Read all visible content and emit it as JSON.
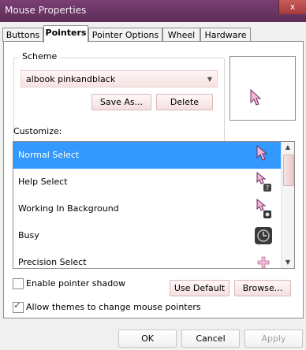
{
  "window": {
    "title": "Mouse Properties",
    "close_label": "x"
  },
  "tabs": [
    {
      "label": "Buttons"
    },
    {
      "label": "Pointers"
    },
    {
      "label": "Pointer Options"
    },
    {
      "label": "Wheel"
    },
    {
      "label": "Hardware"
    }
  ],
  "scheme": {
    "group_label": "Scheme",
    "selected": "albook pinkandblack",
    "save_as_label": "Save As...",
    "delete_label": "Delete"
  },
  "customize": {
    "label": "Customize:",
    "items": [
      {
        "label": "Normal Select",
        "icon": "pink-arrow-cursor-icon"
      },
      {
        "label": "Help Select",
        "icon": "pink-help-cursor-icon"
      },
      {
        "label": "Working In Background",
        "icon": "pink-working-cursor-icon"
      },
      {
        "label": "Busy",
        "icon": "busy-clock-cursor-icon"
      },
      {
        "label": "Precision Select",
        "icon": "pink-cross-cursor-icon"
      }
    ],
    "selected_index": 0
  },
  "options": {
    "enable_shadow_label": "Enable pointer shadow",
    "enable_shadow_checked": false,
    "allow_themes_label": "Allow themes to change mouse pointers",
    "allow_themes_checked": true,
    "use_default_label": "Use Default",
    "browse_label": "Browse..."
  },
  "footer": {
    "ok_label": "OK",
    "cancel_label": "Cancel",
    "apply_label": "Apply"
  },
  "colors": {
    "accent": "#3399ff",
    "titlebar": "#6a3464",
    "cursor_pink": "#f4b6d6"
  }
}
